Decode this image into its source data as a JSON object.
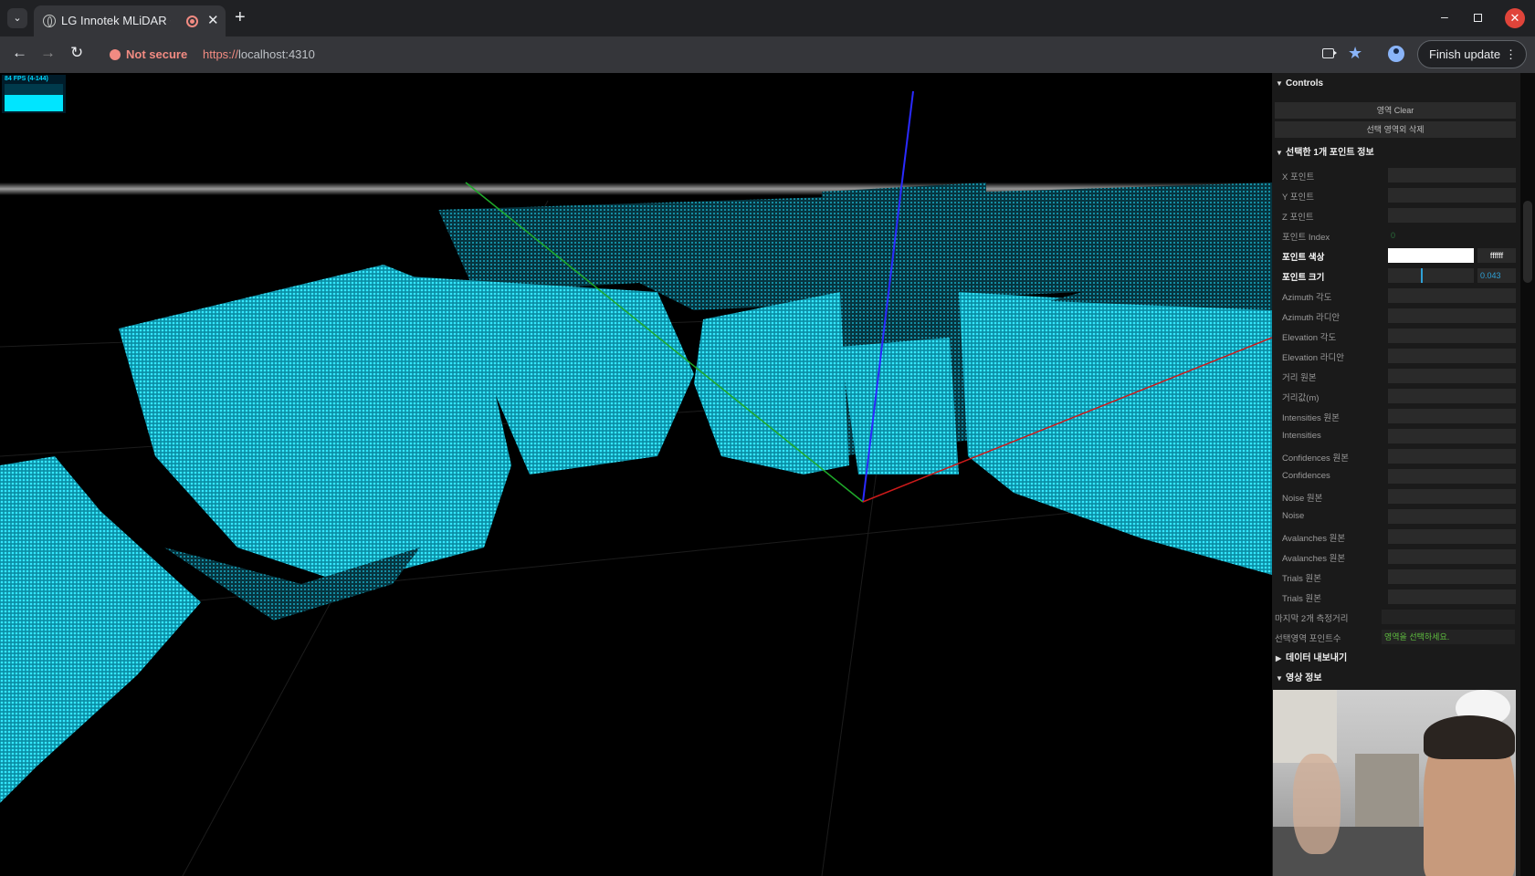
{
  "browser": {
    "tab_title": "LG Innotek MLiDAR C",
    "new_tab": "+",
    "close": "✕",
    "url_security": "Not secure",
    "url_scheme": "https://",
    "url_host": "localhost:4310",
    "finish_update": "Finish update"
  },
  "fps": {
    "label": "84 FPS (4-144)"
  },
  "panel": {
    "controls_header": "Controls",
    "buttons": [
      "영역 Clear",
      "선택 영역외 삭제"
    ],
    "selected_section": "선택한 1개 포인트 정보",
    "point_color_label": "포인트 색상",
    "point_color_value": "ffffff",
    "point_size_label": "포인트 크기",
    "point_size_value": "0.043",
    "point_size_fraction": 0.4,
    "rows": [
      {
        "label": "X 포인트",
        "value": ""
      },
      {
        "label": "Y 포인트",
        "value": ""
      },
      {
        "label": "Z 포인트",
        "value": ""
      },
      {
        "label": "포인트 Index",
        "value": "0"
      }
    ],
    "rows2": [
      {
        "label": "Azimuth 각도",
        "value": ""
      },
      {
        "label": "Azimuth 라디안",
        "value": ""
      },
      {
        "label": "Elevation 각도",
        "value": ""
      },
      {
        "label": "Elevation 라디안",
        "value": ""
      },
      {
        "label": "거리 원본",
        "value": ""
      },
      {
        "label": "거리값(m)",
        "value": ""
      },
      {
        "label": "Intensities 원본",
        "value": ""
      },
      {
        "label": "Intensities",
        "value": ""
      },
      {
        "label": "Confidences 원본",
        "value": ""
      },
      {
        "label": "Confidences",
        "value": ""
      },
      {
        "label": "Noise 원본",
        "value": ""
      },
      {
        "label": "Noise",
        "value": ""
      },
      {
        "label": "Avalanches 원본",
        "value": ""
      },
      {
        "label": "Avalanches 원본",
        "value": ""
      },
      {
        "label": "Trials 원본",
        "value": ""
      },
      {
        "label": "Trials 원본",
        "value": ""
      }
    ],
    "last_measure_label": "마지막 2개 측정거리",
    "last_measure_value": "",
    "region_points_label": "선택영역 포인트수",
    "region_points_value": "영역을 선택하세요.",
    "export_section": "데이터 내보내기",
    "video_section": "영상 정보"
  }
}
